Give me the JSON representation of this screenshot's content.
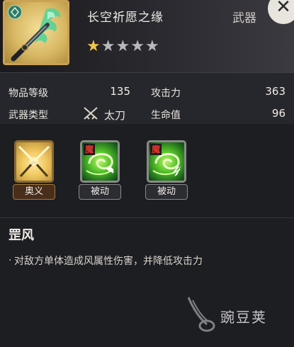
{
  "item": {
    "name": "长空祈愿之缘",
    "type": "武器",
    "rarity_stars": 1,
    "max_stars": 5,
    "close_glyph": "✕"
  },
  "stats": {
    "level_label": "物品等级",
    "level_value": "135",
    "attack_label": "攻击力",
    "attack_value": "363",
    "weapon_type_label": "武器类型",
    "weapon_type_value": "太刀",
    "hp_label": "生命值",
    "hp_value": "96"
  },
  "skills": [
    {
      "label": "奥义",
      "style": "gold"
    },
    {
      "label": "被动",
      "style": "green",
      "tag": "魔"
    },
    {
      "label": "被动",
      "style": "green",
      "tag": "魔"
    }
  ],
  "selected_skill": {
    "name": "罡风",
    "bullet": "·",
    "description": "对敌方单体造成风属性伤害，并降低攻击力"
  },
  "watermark": {
    "text": "豌豆荚"
  },
  "colors": {
    "gold": "#caa254",
    "green": "#55c22b",
    "demon_red": "#e0342c",
    "star": "#f0c44c"
  }
}
